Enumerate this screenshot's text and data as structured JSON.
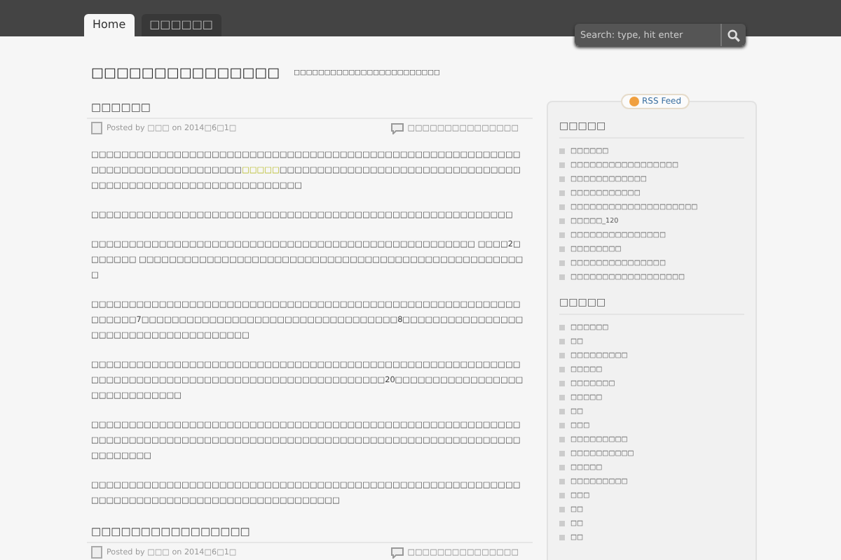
{
  "nav": {
    "tabs": [
      {
        "label": "Home",
        "selected": true
      },
      {
        "label": "□□□□□□",
        "selected": false
      }
    ],
    "search": {
      "placeholder": "Search: type, hit enter"
    }
  },
  "site": {
    "title": "□□□□□□□□□□□□□□□",
    "tagline": "□□□□□□□□□□□□□□□□□□□□□□□□"
  },
  "posts": [
    {
      "title": "□□□□□□",
      "meta": "Posted by □□□ on 2014□6□1□",
      "comments": "□□□□□□□□□□□□□□□",
      "paragraphs": [
        [
          {
            "kind": "text",
            "text": "□□□□□□□□□□□□□□□□□□□□□□□□□□□□□□□□□□□□□□□□□□□□□□□□□□□□□□□□□□□□□□□□□□□□□□□□□□□□□"
          },
          {
            "kind": "link",
            "text": "□□□□□"
          },
          {
            "kind": "text",
            "text": "□□□□□□□□□□□□□□□□□□□□□□□□□□□□□□□□□□□□□□□□□□□□□□□□□□□□□□□□□□□□"
          }
        ],
        [
          {
            "kind": "text",
            "text": "□□□□□□□□□□□□□□□□□□□□□□□□□□□□□□□□□□□□□□□□□□□□□□□□□□□□□□□□"
          }
        ],
        [
          {
            "kind": "text",
            "text": "□□□□□□□□□□□□□□□□□□□□□□□□□□□□□□□□□□□□□□□□□□□□□□□□□□□ □□□□2□□□□□□□ □□□□□□□□□□□□□□□□□□□□□□□□□□□□□□□□□□□□□□□□□□□□□□□□□□□□"
          }
        ],
        [
          {
            "kind": "text",
            "text": "□□□□□□□□□□□□□□□□□□□□□□□□□□□□□□□□□□□□□□□□□□□□□□□□□□□□□□□□□□□□□□□7□□□□□□□□□□□□□□□□□□□□□□□□□□□□□□□□□□8□□□□□□□□□□□□□□□□□□□□□□□□□□□□□□□□□□□□□"
          }
        ],
        [
          {
            "kind": "text",
            "text": "□□□□□□□□□□□□□□□□□□□□□□□□□□□□□□□□□□□□□□□□□□□□□□□□□□□□□□□□□□□□□□□□□□□□□□□□□□□□□□□□□□□□□□□□□□□□□□□□20□□□□□□□□□□□□□□□□□□□□□□□□□□□□□"
          }
        ],
        [
          {
            "kind": "text",
            "text": "□□□□□□□□□□□□□□□□□□□□□□□□□□□□□□□□□□□□□□□□□□□□□□□□□□□□□□□□□□□□□□□□□□□□□□□□□□□□□□□□□□□□□□□□□□□□□□□□□□□□□□□□□□□□□□□□□□□□□□□□□□"
          }
        ],
        [
          {
            "kind": "text",
            "text": "□□□□□□□□□□□□□□□□□□□□□□□□□□□□□□□□□□□□□□□□□□□□□□□□□□□□□□□□□□□□□□□□□□□□□□□□□□□□□□□□□□□□□□□□□□"
          }
        ]
      ]
    },
    {
      "title": "□□□□□□□□□□□□□□□□",
      "meta": "Posted by □□□ on 2014□6□1□",
      "comments": "□□□□□□□□□□□□□□□"
    }
  ],
  "sidebar": {
    "rss": "RSS Feed",
    "widgets": [
      {
        "title": "□□□□□",
        "items": [
          "□□□□□□",
          "□□□□□□□□□□□□□□□□□",
          "□□□□□□□□□□□□",
          "□□□□□□□□□□□",
          "□□□□□□□□□□□□□□□□□□□□",
          "□□□□□_120",
          "□□□□□□□□□□□□□□□",
          "□□□□□□□□",
          "□□□□□□□□□□□□□□□",
          "□□□□□□□□□□□□□□□□□□"
        ]
      },
      {
        "title": "□□□□□",
        "items": [
          "□□□□□□",
          "□□",
          "□□□□□□□□□",
          "□□□□□",
          "□□□□□□□",
          "□□□□□",
          "□□",
          "□□□",
          "□□□□□□□□□",
          "□□□□□□□□□□",
          "□□□□□",
          "□□□□□□□□□",
          "□□□",
          "□□",
          "□□",
          "□□"
        ]
      }
    ]
  }
}
